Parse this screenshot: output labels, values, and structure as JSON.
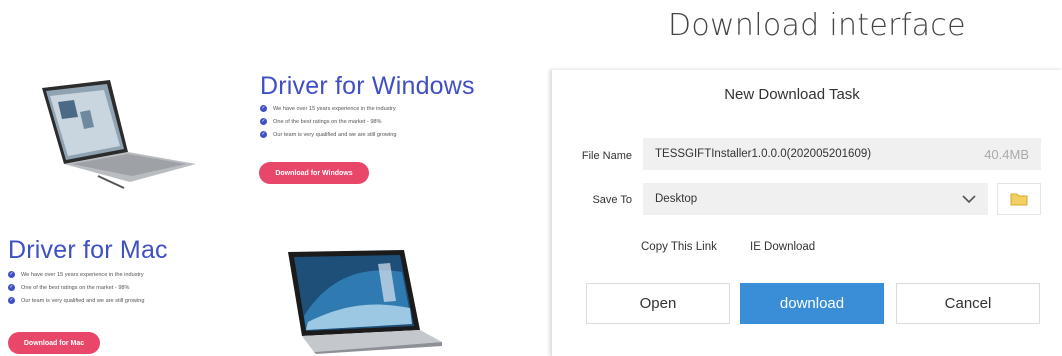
{
  "heading": "Download interface",
  "windows_promo": {
    "title": "Driver for Windows",
    "features": [
      "We have over 15 years experience in the industry",
      "One of the best ratings on the market - 98%",
      "Our team is very qualified and we are still growing"
    ],
    "button_label": "Download for Windows"
  },
  "mac_promo": {
    "title": "Driver for Mac",
    "features": [
      "We have over 15 years experience in the industry",
      "One of the best ratings on the market - 98%",
      "Our team is very qualified and we are still growing"
    ],
    "button_label": "Download for Mac"
  },
  "dialog": {
    "title": "New Download Task",
    "file_name_label": "File Name",
    "file_name_value": "TESSGIFTInstaller1.0.0.0(202005201609)",
    "file_size": "40.4MB",
    "save_to_label": "Save To",
    "save_to_value": "Desktop",
    "copy_link_label": "Copy This Link",
    "ie_download_label": "IE Download",
    "open_label": "Open",
    "download_label": "download",
    "cancel_label": "Cancel"
  },
  "icons": {
    "check": "check-circle-icon",
    "chevron": "chevron-down-icon",
    "folder": "folder-icon"
  },
  "colors": {
    "promo_title": "#3f4fc4",
    "promo_button": "#e8476a",
    "primary_button": "#3a8ed8",
    "folder": "#f3cf63"
  }
}
